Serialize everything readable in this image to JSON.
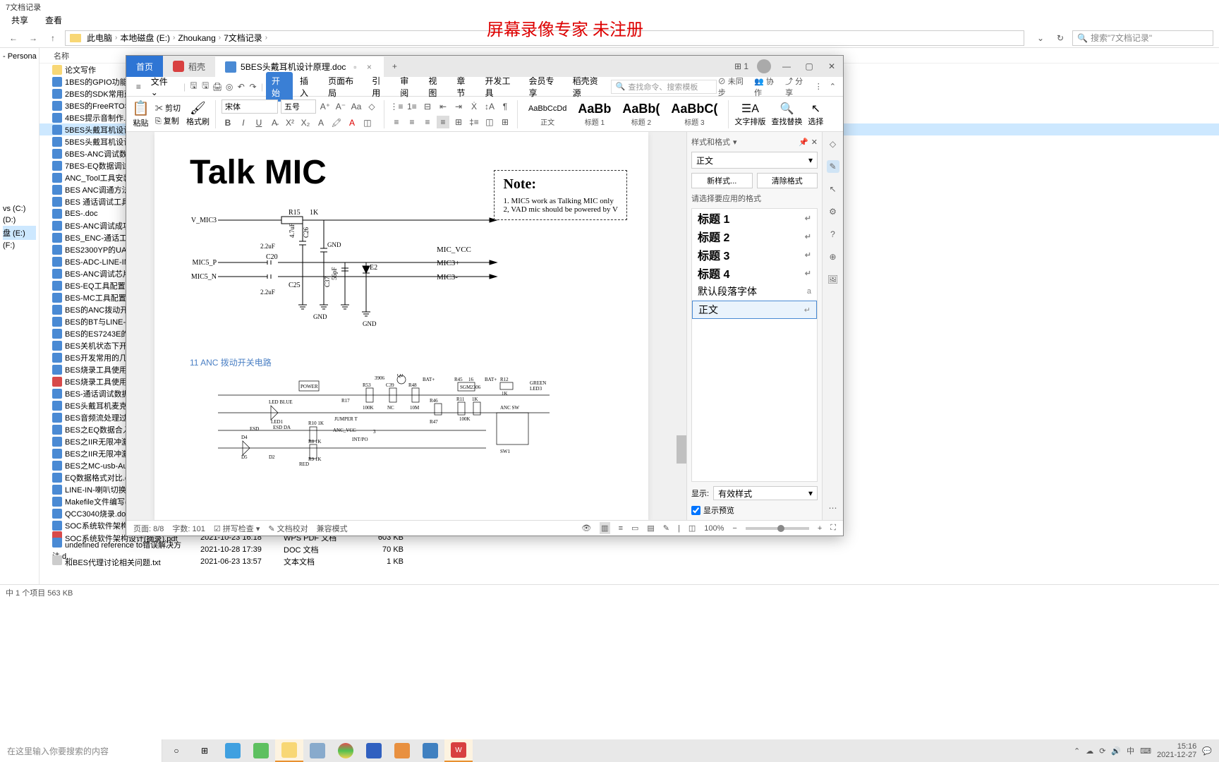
{
  "explorer": {
    "title": "7文档记录",
    "menu": {
      "share": "共享",
      "view": "查看"
    },
    "breadcrumb": [
      "此电脑",
      "本地磁盘 (E:)",
      "Zhoukang",
      "7文档记录"
    ],
    "search_placeholder": "搜索\"7文档记录\"",
    "name_col": "名称",
    "tree": [
      "- Persona",
      "vs (C:)",
      "(D:)",
      "盘 (E:)",
      "(F:)"
    ],
    "files": [
      {
        "n": "论文写作",
        "t": "folder"
      },
      {
        "n": "1BES的GPIO功能配置",
        "t": "doc"
      },
      {
        "n": "2BES的SDK常用蓝牙A",
        "t": "doc"
      },
      {
        "n": "3BES的FreeRTOS实验",
        "t": "doc"
      },
      {
        "n": "4BES提示音制作.doc",
        "t": "doc"
      },
      {
        "n": "5BES头戴耳机设计原理",
        "t": "doc",
        "sel": true
      },
      {
        "n": "5BES头戴耳机设计原理",
        "t": "doc"
      },
      {
        "n": "6BES-ANC调试数据合",
        "t": "doc"
      },
      {
        "n": "7BES-EQ数据调试合成",
        "t": "doc"
      },
      {
        "n": "ANC_Tool工具安装方法",
        "t": "doc"
      },
      {
        "n": "BES ANC调通方法.doc",
        "t": "doc"
      },
      {
        "n": "BES 通话调试工具Aud",
        "t": "doc"
      },
      {
        "n": "BES-.doc",
        "t": "doc"
      },
      {
        "n": "BES-ANC调试成功.doc",
        "t": "doc"
      },
      {
        "n": "BES_ENC-通话工具调",
        "t": "doc"
      },
      {
        "n": "BES2300YP的UART.do",
        "t": "doc"
      },
      {
        "n": "BES-ADC-LINE-IN调试",
        "t": "doc"
      },
      {
        "n": "BES-ANC调试芯片发货",
        "t": "doc"
      },
      {
        "n": "BES-EQ工具配置使用方",
        "t": "doc"
      },
      {
        "n": "BES-MC工具配置使用方",
        "t": "doc"
      },
      {
        "n": "BES的ANC拨动开关开",
        "t": "doc"
      },
      {
        "n": "BES的BT与LINE-in-场",
        "t": "doc"
      },
      {
        "n": "BES的ES7243E的I2C代",
        "t": "doc"
      },
      {
        "n": "BES关机状态下开ANC",
        "t": "doc"
      },
      {
        "n": "BES开发常用的几个文",
        "t": "doc"
      },
      {
        "n": "BES烧录工具使用说明.",
        "t": "doc"
      },
      {
        "n": "BES烧录工具使用说明.",
        "t": "pdf"
      },
      {
        "n": "BES-通话调试数据合成",
        "t": "doc"
      },
      {
        "n": "BES头戴耳机麦克风设",
        "t": "doc"
      },
      {
        "n": "BES音频流处理过程.do",
        "t": "doc"
      },
      {
        "n": "BES之EQ数据合入.doc",
        "t": "doc"
      },
      {
        "n": "BES之IIR无限冲激响应",
        "t": "doc"
      },
      {
        "n": "BES之IIR无限冲激响应",
        "t": "doc"
      },
      {
        "n": "BES之MC-usb-Audio之",
        "t": "doc"
      },
      {
        "n": "EQ数据格式对比.doc",
        "t": "doc"
      },
      {
        "n": "LINE-IN-喇叭切换开关",
        "t": "doc"
      },
      {
        "n": "Makefile文件编写(摘录",
        "t": "doc"
      },
      {
        "n": "QCC3040烧录.doc",
        "t": "doc"
      },
      {
        "n": "SOC系统软件架构设计",
        "t": "doc"
      }
    ],
    "tail": [
      {
        "n": "SOC系统软件架构设计(摘录).pdf",
        "d": "2021-10-23 16:18",
        "tp": "WPS PDF 文档",
        "s": "603 KB",
        "t": "pdf"
      },
      {
        "n": "undefined reference to错误解决方法.d...",
        "d": "2021-10-28 17:39",
        "tp": "DOC 文档",
        "s": "70 KB",
        "t": "doc"
      },
      {
        "n": "和BES代理讨论相关问题.txt",
        "d": "2021-06-23 13:57",
        "tp": "文本文档",
        "s": "1 KB",
        "t": "txt"
      }
    ],
    "status": "中 1 个项目  563 KB"
  },
  "watermark": "屏幕录像专家  未注册",
  "wps": {
    "tabs": {
      "home": "首页",
      "dao": "稻壳",
      "doc": "5BES头戴耳机设计原理.doc"
    },
    "menu": {
      "file": "文件",
      "start": "开始",
      "insert": "插入",
      "layout": "页面布局",
      "ref": "引用",
      "review": "审阅",
      "view": "视图",
      "chapter": "章节",
      "dev": "开发工具",
      "member": "会员专享",
      "dao": "稻壳资源",
      "search": "查找命令、搜索模板",
      "unsync": "未同步",
      "coop": "协作",
      "share": "分享"
    },
    "ribbon": {
      "paste": "粘贴",
      "cut": "剪切",
      "copy": "复制",
      "format": "格式刷",
      "font": "宋体",
      "size": "五号",
      "styles": [
        {
          "preview": "AaBbCcDd",
          "name": "正文"
        },
        {
          "preview": "AaBb",
          "name": "标题 1"
        },
        {
          "preview": "AaBb(",
          "name": "标题 2"
        },
        {
          "preview": "AaBbC(",
          "name": "标题 3"
        }
      ],
      "typeset": "文字排版",
      "findreplace": "查找替换",
      "select": "选择"
    },
    "doc": {
      "title": "Talk MIC",
      "note_title": "Note:",
      "note1": "1. MIC5  work as Talking MIC only",
      "note2": "2, VAD mic should be powered by V",
      "labels": {
        "vmic3": "V_MIC3",
        "r15": "R15",
        "k1": "1K",
        "c20": "C20",
        "c25": "C25",
        "c26": "C26",
        "c37": "C37",
        "u22a": "2.2uF",
        "u22b": "2.2uF",
        "u47": "4.7uF",
        "p56": "56pF",
        "e2": "E2",
        "gnd": "GND",
        "mic5p": "MIC5_P",
        "mic5n": "MIC5_N",
        "micvcc": "MIC_VCC",
        "mic3p": "MIC3+",
        "mic3n": "MIC3-"
      },
      "caption": "11 ANC 拨动开关电路",
      "c2": {
        "power": "POWER",
        "ledblue": "LED BLUE",
        "led1": "LED1",
        "esdda": "ESD DA",
        "esd": "ESD",
        "r10": "R10  1K",
        "r8": "R8    1K",
        "r9": "R9    1K",
        "d4": "D4",
        "d5": "D5",
        "d2": "D2",
        "red": "RED",
        "r17": "R17",
        "r53": "R53",
        "c39": "C39",
        "r48": "R48",
        "r46": "R46",
        "r47": "R47",
        "r11": "R11",
        "r45": "R45",
        "r12": "R12",
        "hundredk": "100K",
        "k1": "1K",
        "nc": "NC",
        "m10": "10M",
        "sgm": "SGM2306",
        "r16": "16",
        "q2": "Q2",
        "a3906": "3906",
        "batp": "BAT+",
        "anc": "ANC SW",
        "sw1": "SW1",
        "green": "GREEN",
        "led3": "LED3",
        "ancvcc": "ANC_VCC",
        "jumper": "JUMPER  T",
        "intpo": "INT/PO",
        "three": "3"
      }
    },
    "panel": {
      "title": "样式和格式",
      "current": "正文",
      "new": "新样式...",
      "clear": "清除格式",
      "prompt": "请选择要应用的格式",
      "items": [
        "标题 1",
        "标题 2",
        "标题 3",
        "标题 4",
        "默认段落字体",
        "正文"
      ],
      "show": "显示:",
      "show_val": "有效样式",
      "preview": "显示预览"
    },
    "status": {
      "page": "页面: 8/8",
      "words": "字数: 101",
      "spell": "拼写检查",
      "proof": "文档校对",
      "compat": "兼容模式",
      "zoom": "100%"
    }
  },
  "taskbar": {
    "search": "在这里输入你要搜索的内容",
    "time": "15:16",
    "date": "2021-12-27",
    "ime": "中"
  }
}
